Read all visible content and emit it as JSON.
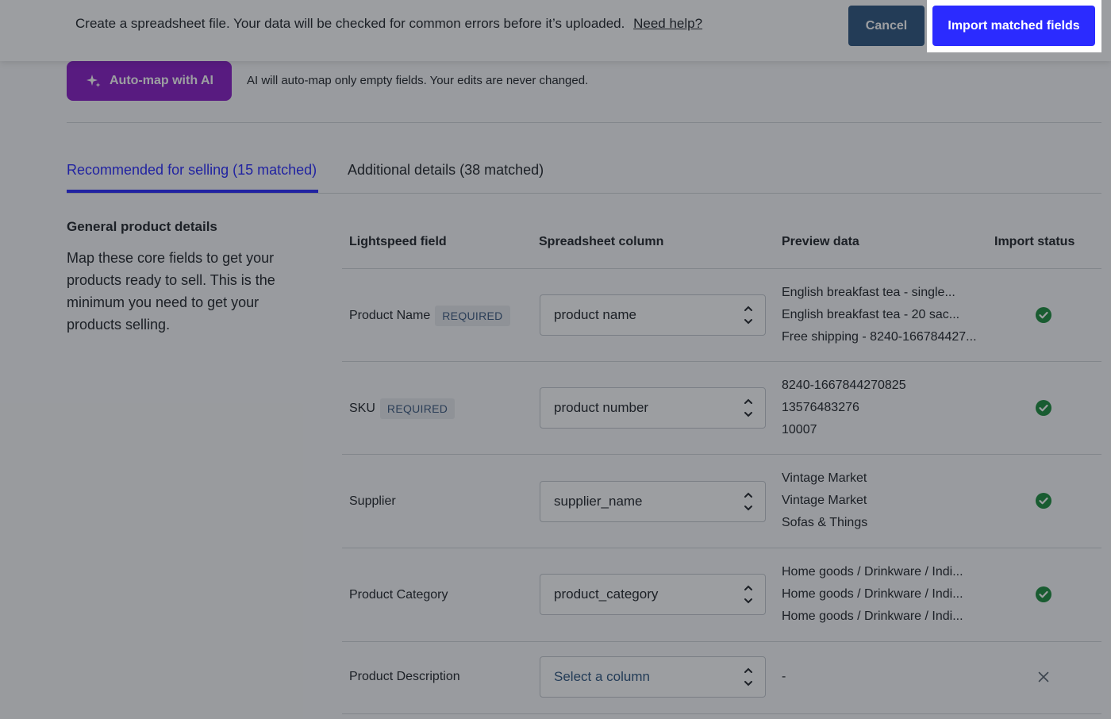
{
  "header": {
    "instruction": "Create a spreadsheet file. Your data will be checked for common errors before it’s uploaded.",
    "help_link": "Need help?",
    "cancel_label": "Cancel",
    "import_label": "Import matched fields"
  },
  "automap": {
    "button_label": "Auto-map with AI",
    "note": "AI will auto-map only empty fields. Your edits are never changed."
  },
  "tabs": [
    {
      "label": "Recommended for selling (15 matched)",
      "active": true
    },
    {
      "label": "Additional details (38 matched)",
      "active": false
    }
  ],
  "section": {
    "title": "General product details",
    "description": "Map these core fields to get your products ready to sell. This is the minimum you need to get your products selling."
  },
  "table": {
    "headers": {
      "field": "Lightspeed field",
      "column": "Spreadsheet column",
      "preview": "Preview data",
      "status": "Import status"
    },
    "rows": [
      {
        "field": "Product Name",
        "badge": "REQUIRED",
        "column": "product name",
        "preview": [
          "English breakfast tea - single...",
          "English breakfast tea - 20 sac...",
          "Free shipping - 8240-166784427..."
        ],
        "status": "matched"
      },
      {
        "field": "SKU",
        "badge": "REQUIRED",
        "column": "product number",
        "preview": [
          "8240-1667844270825",
          "13576483276",
          "10007"
        ],
        "status": "matched"
      },
      {
        "field": "Supplier",
        "badge": "",
        "column": "supplier_name",
        "preview": [
          "Vintage Market",
          "Vintage Market",
          "Sofas & Things"
        ],
        "status": "matched"
      },
      {
        "field": "Product Category",
        "badge": "",
        "column": "product_category",
        "preview": [
          "Home goods / Drinkware / Indi...",
          "Home goods / Drinkware / Indi...",
          "Home goods / Drinkware / Indi..."
        ],
        "status": "matched"
      },
      {
        "field": "Product Description",
        "badge": "",
        "column": "Select a column",
        "preview": [
          "-"
        ],
        "status": "unmatched"
      }
    ]
  },
  "colors": {
    "primary": "#2b2bff",
    "ai_purple": "#8a1ec7",
    "cancel": "#2f5680",
    "success": "#1e8e3e",
    "overlay": "rgba(20,24,30,0.42)"
  },
  "icons": [
    "sparkle-icon",
    "chevron-updown-icon",
    "check-circle-icon",
    "close-icon"
  ]
}
